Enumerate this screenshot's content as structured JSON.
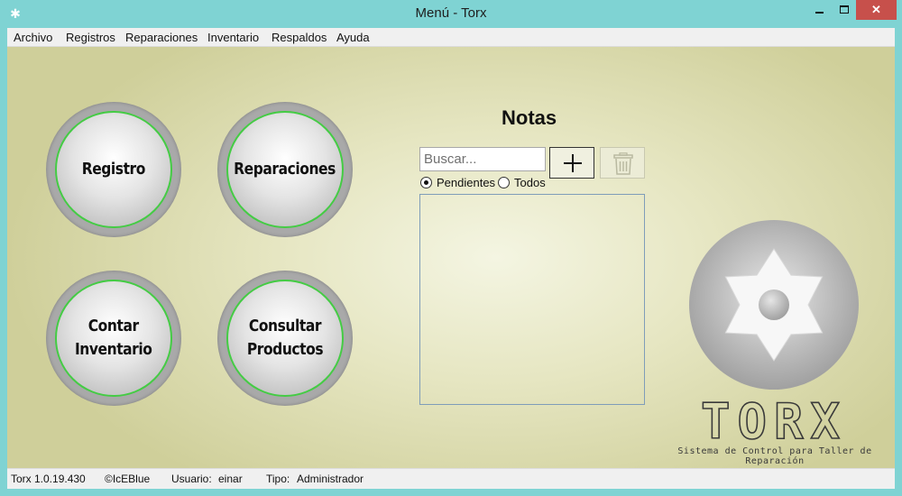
{
  "window": {
    "title": "Menú - Torx",
    "close_label": "✕"
  },
  "menu": [
    "Archivo",
    "Registros",
    "Reparaciones",
    "Inventario",
    "Respaldos",
    "Ayuda"
  ],
  "tiles": {
    "registro": "Registro",
    "reparaciones": "Reparaciones",
    "contar_inventario": "Contar\nInventario",
    "consultar_productos": "Consultar\nProductos"
  },
  "notes": {
    "title": "Notas",
    "search_placeholder": "Buscar...",
    "filter_pending": "Pendientes",
    "filter_all": "Todos",
    "selected_filter": "Pendientes"
  },
  "brand": {
    "name": "TORX",
    "tagline": "Sistema de Control para Taller de Reparación"
  },
  "status": {
    "version": "Torx 1.0.19.430",
    "copyright": "©IcEBlue",
    "user_label": "Usuario:",
    "user_value": "einar",
    "type_label": "Tipo:",
    "type_value": "Administrador"
  },
  "colors": {
    "chrome": "#7fd3d3",
    "close_button": "#c7504b",
    "tile_ring": "#44cc44",
    "background": "#e6e6c2"
  },
  "icons": [
    "gear-icon",
    "minimize-icon",
    "maximize-icon",
    "close-icon",
    "plus-icon",
    "trash-icon",
    "torx-logo-icon"
  ]
}
